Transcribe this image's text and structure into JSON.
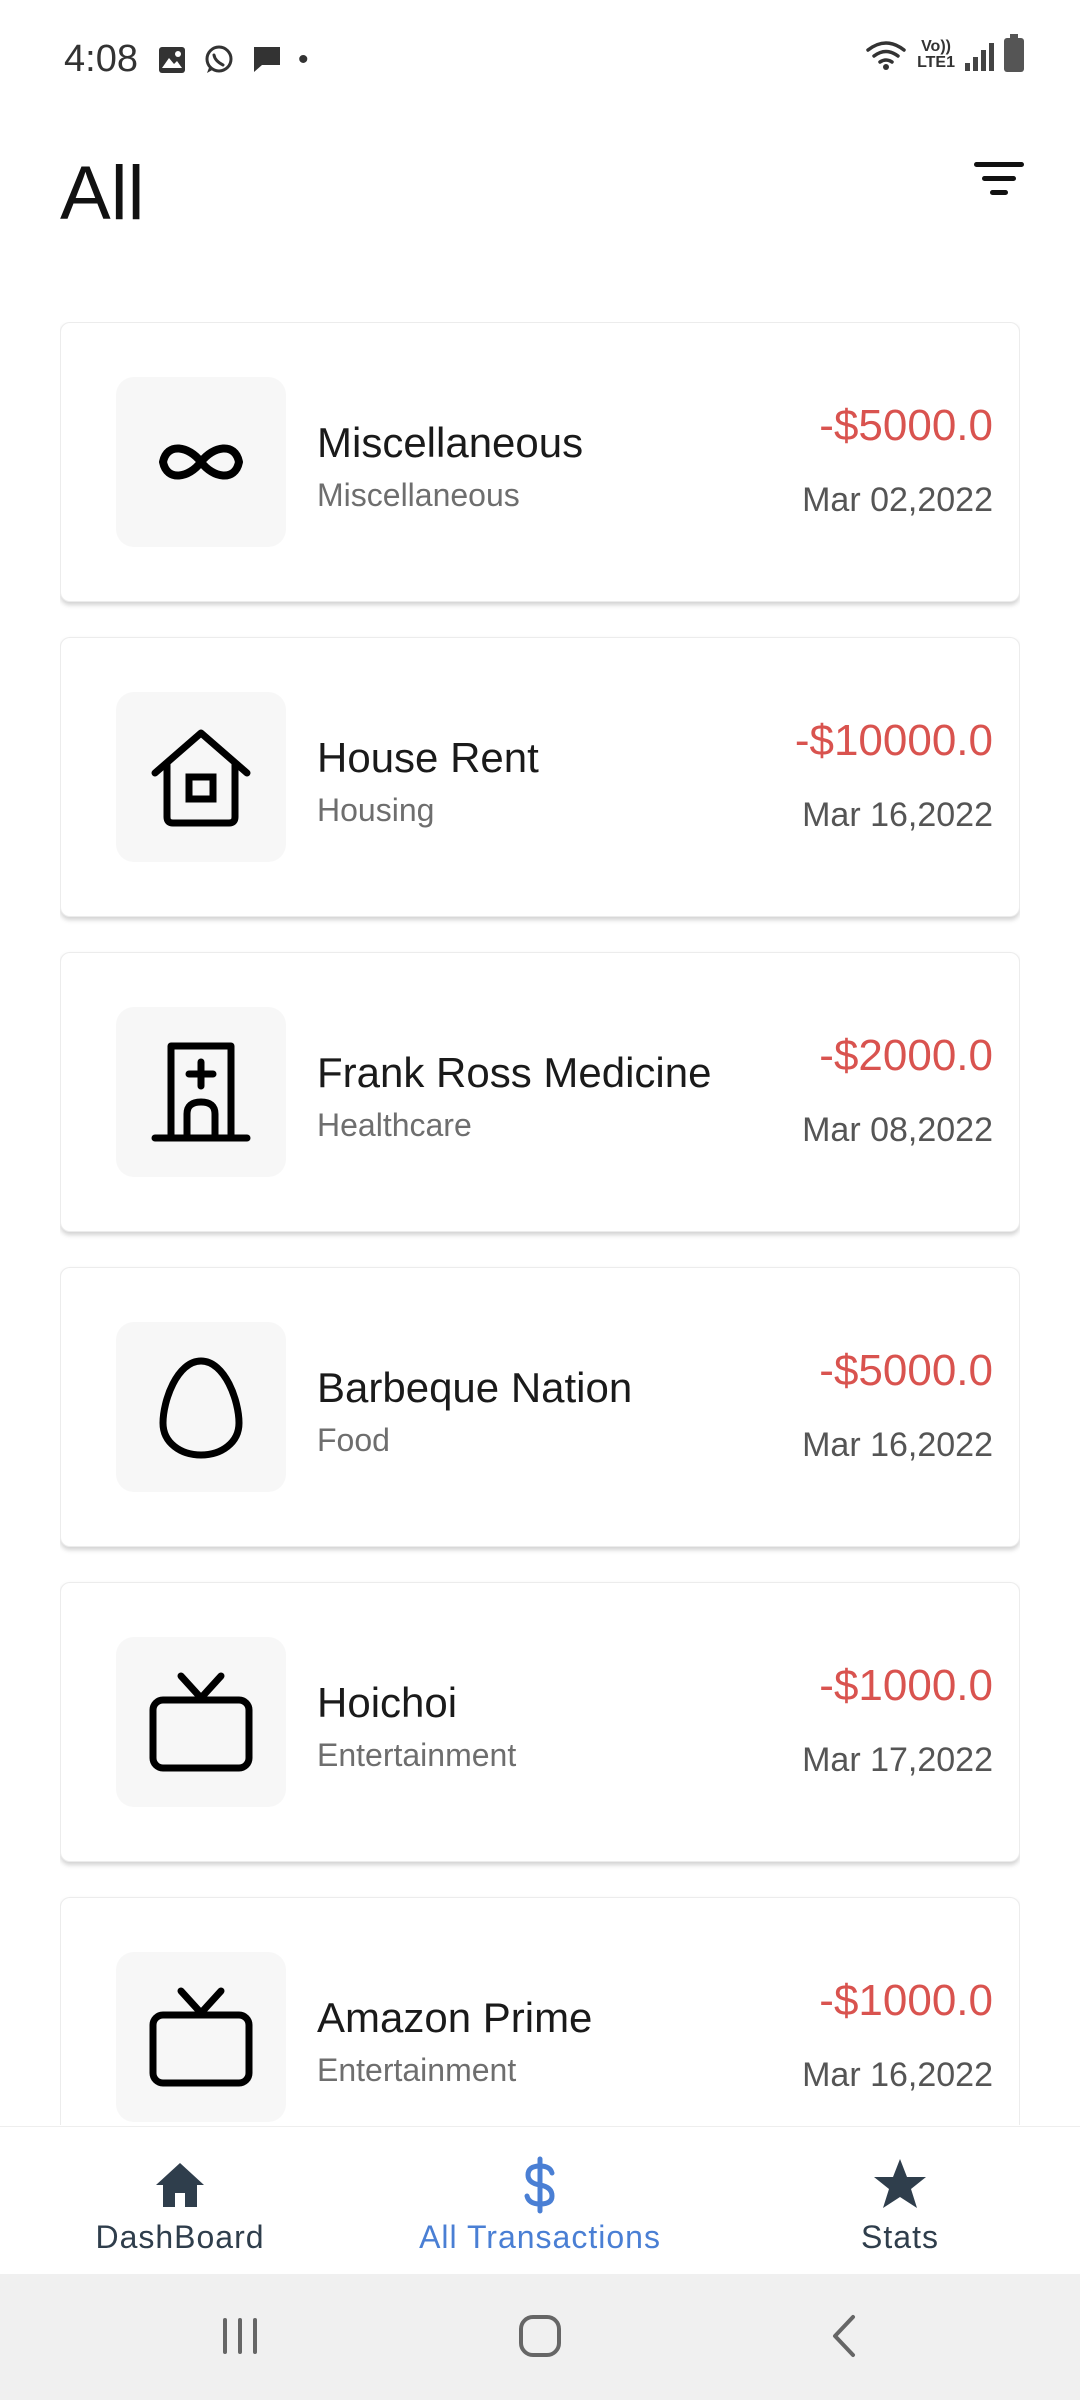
{
  "status_bar": {
    "time": "4:08",
    "dot": "•",
    "left_icons": [
      "gallery-icon",
      "whatsapp-icon",
      "message-icon"
    ],
    "right_icons": [
      "wifi-icon",
      "volte-icon",
      "signal-icon",
      "battery-icon"
    ],
    "lte_label_top": "Vo))",
    "lte_label_bottom": "LTE1"
  },
  "header": {
    "title": "All",
    "filter_icon": "filter-icon"
  },
  "transactions": [
    {
      "title": "Miscellaneous",
      "category": "Miscellaneous",
      "amount": "-$5000.0",
      "date": "Mar 02,2022",
      "icon": "infinity-icon"
    },
    {
      "title": "House Rent",
      "category": "Housing",
      "amount": "-$10000.0",
      "date": "Mar 16,2022",
      "icon": "house-icon"
    },
    {
      "title": "Frank Ross Medicine",
      "category": "Healthcare",
      "amount": "-$2000.0",
      "date": "Mar 08,2022",
      "icon": "hospital-icon"
    },
    {
      "title": "Barbeque Nation",
      "category": "Food",
      "amount": "-$5000.0",
      "date": "Mar 16,2022",
      "icon": "egg-icon"
    },
    {
      "title": "Hoichoi",
      "category": "Entertainment",
      "amount": "-$1000.0",
      "date": "Mar 17,2022",
      "icon": "tv-icon"
    },
    {
      "title": "Amazon Prime",
      "category": "Entertainment",
      "amount": "-$1000.0",
      "date": "Mar 16,2022",
      "icon": "tv-icon"
    }
  ],
  "bottom_nav": {
    "items": [
      {
        "label": "DashBoard",
        "icon": "home-icon",
        "active": false
      },
      {
        "label": "All Transactions",
        "icon": "dollar-icon",
        "active": true
      },
      {
        "label": "Stats",
        "icon": "star-icon",
        "active": false
      }
    ]
  },
  "colors": {
    "amount": "#d9534f",
    "active_nav": "#4a7fd4",
    "inactive_nav": "#2f3e4c"
  }
}
